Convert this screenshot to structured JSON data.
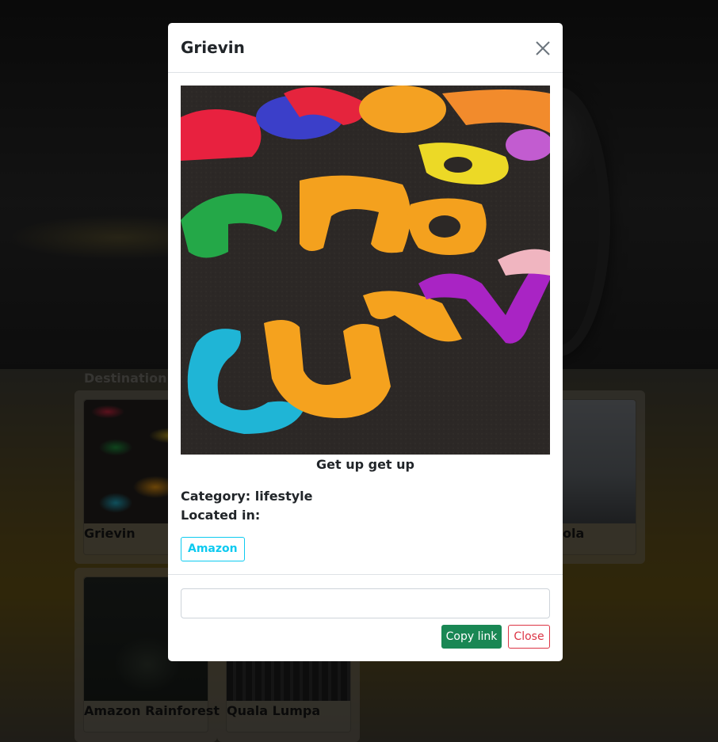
{
  "background": {
    "section_title": "Destination",
    "cards": [
      {
        "title": "Grievin",
        "image": "colorful-felt-letters"
      },
      {
        "title": "ola",
        "image": "stone-arch-with-crowd"
      },
      {
        "title": "Amazon Rainforest",
        "image": "misty-rainforest"
      },
      {
        "title": "Quala Lumpa",
        "image": "dark-tree-trunks"
      }
    ]
  },
  "modal": {
    "title": "Grievin",
    "close_icon": "close-icon",
    "image": "colorful-felt-letters",
    "caption": "Get up get up",
    "category_label": "Category: lifestyle",
    "located_label": "Located in:",
    "location_tag": "Amazon",
    "link_input": {
      "value": "",
      "placeholder": ""
    },
    "copy_button": "Copy link",
    "close_button": "Close"
  },
  "colors": {
    "copy_button": "#198754",
    "close_button": "#dc3545",
    "tag": "#0dcaf0"
  }
}
